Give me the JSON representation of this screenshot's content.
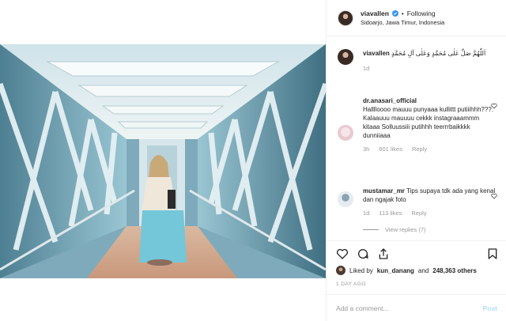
{
  "header": {
    "username": "viavallen",
    "separator": "•",
    "follow_label": "Following",
    "location": "Sidoarjo, Jawa Timur, Indonesia"
  },
  "caption": {
    "username": "viavallen",
    "text": "اَللّٰهُمَّ صَلِّ عَلٰى مُحَمَّدٍ وَعَلٰى آلِ مُحَمَّدٍ",
    "age": "1d"
  },
  "comments": [
    {
      "username": "dr.anasari_official",
      "text": "Halllloooo mauuu punyaaa kullittt putiiihhh???. Kalaauuu mauuuu cekkk instagraaammm kitaaa Solluussiii putihhh teerrrbaikkkk dunniiaaa",
      "age": "3h",
      "likes": "601 likes",
      "reply_label": "Reply"
    },
    {
      "username": "mustamar_mr",
      "text": "Tips supaya tdk ada yang kenal dan ngajak foto",
      "age": "1d",
      "likes": "113 likes",
      "reply_label": "Reply"
    }
  ],
  "view_replies": "View replies (7)",
  "likes": {
    "prefix": "Liked by",
    "user": "kun_danang",
    "conj": "and",
    "count": "248,363 others"
  },
  "time_ago": "1 DAY AGO",
  "add_comment": {
    "placeholder": "Add a comment...",
    "post_label": "Post"
  },
  "icons": {
    "like": "heart-icon",
    "comment": "comment-icon",
    "share": "share-icon",
    "save": "bookmark-icon",
    "verified": "verified-badge-icon"
  },
  "colors": {
    "accent": "#3897f0",
    "post_disabled": "#b2dffc",
    "muted": "#999999"
  }
}
